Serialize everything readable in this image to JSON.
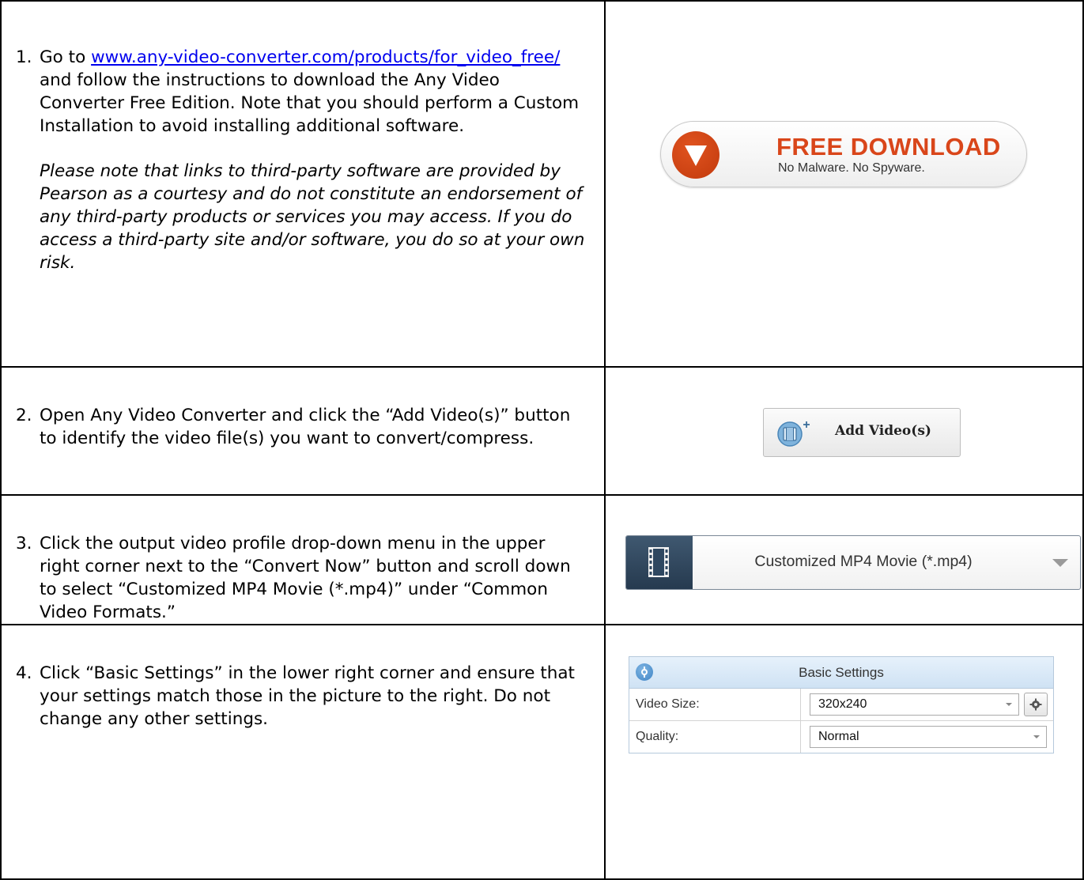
{
  "steps": [
    {
      "number": "1.",
      "prefix": "Go to ",
      "link": "www.any-video-converter.com/products/for_video_free/",
      "rest": " and follow the instructions to download the Any Video Converter Free Edition. Note that you should perform a Custom Installation to avoid installing additional software.",
      "note": "Please note that links to third-party software are provided by Pearson as a courtesy and do not constitute an endorsement of any third-party products or services you may access. If you do access a third-party site and/or software, you do so at your own risk."
    },
    {
      "number": "2.",
      "text": "Open Any Video Converter and click the “Add Video(s)” button to identify the video file(s) you want to convert/compress."
    },
    {
      "number": "3.",
      "text": "Click the output video profile drop-down menu in the upper right corner next to the “Convert Now” button and scroll down to select “Customized MP4 Movie (*.mp4)” under “Common Video Formats.”"
    },
    {
      "number": "4.",
      "text": "Click “Basic Settings” in the lower right corner and ensure that your settings match those in the picture to the right.  Do not change any other settings."
    }
  ],
  "free_download": {
    "title": "FREE DOWNLOAD",
    "subtitle": "No Malware. No Spyware.",
    "icon": "download-arrow-icon",
    "color": "#d9461a"
  },
  "add_video": {
    "label": "Add Video(s)",
    "icon": "film-add-icon"
  },
  "profile_dropdown": {
    "selected": "Customized MP4 Movie (*.mp4)",
    "icon": "film-icon"
  },
  "basic_settings": {
    "title": "Basic Settings",
    "rows": [
      {
        "label": "Video Size:",
        "value": "320x240"
      },
      {
        "label": "Quality:",
        "value": "Normal"
      }
    ]
  }
}
